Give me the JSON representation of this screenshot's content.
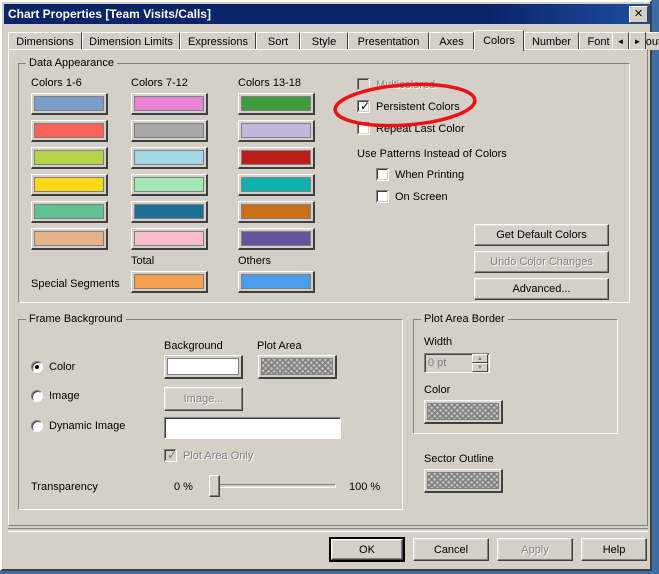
{
  "window": {
    "title": "Chart Properties [Team Visits/Calls]",
    "close_label": "✕"
  },
  "tabs": {
    "items": [
      {
        "label": "Dimensions",
        "active": false
      },
      {
        "label": "Dimension Limits",
        "active": false
      },
      {
        "label": "Expressions",
        "active": false
      },
      {
        "label": "Sort",
        "active": false
      },
      {
        "label": "Style",
        "active": false
      },
      {
        "label": "Presentation",
        "active": false
      },
      {
        "label": "Axes",
        "active": false
      },
      {
        "label": "Colors",
        "active": true
      },
      {
        "label": "Number",
        "active": false
      },
      {
        "label": "Font",
        "active": false
      },
      {
        "label": "Layout",
        "active": false
      }
    ],
    "scroll_left": "◄",
    "scroll_right": "►"
  },
  "data_appearance": {
    "group_label": "Data Appearance",
    "col1_label": "Colors 1-6",
    "col2_label": "Colors 7-12",
    "col3_label": "Colors 13-18",
    "special_segments_label": "Special Segments",
    "total_label": "Total",
    "others_label": "Others",
    "colors_1_6": [
      "#7b9dcb",
      "#f8615a",
      "#b5d44a",
      "#f7d917",
      "#5fc294",
      "#e8b38a"
    ],
    "colors_7_12": [
      "#ea82d6",
      "#a8a8a8",
      "#a3d7e8",
      "#a3e9b4",
      "#1a6f96",
      "#f8bccb"
    ],
    "colors_13_18": [
      "#3e9e3e",
      "#c4b5de",
      "#bb1d1d",
      "#10b0ad",
      "#cc7018",
      "#66519b"
    ],
    "total_color": "#f4a košt",
    "total_color_hex": "#f4a04d",
    "others_color_hex": "#4a9ded",
    "checkboxes": [
      {
        "label": "Multicolored",
        "checked": false,
        "disabled": true
      },
      {
        "label": "Persistent Colors",
        "checked": true,
        "disabled": false
      },
      {
        "label": "Repeat Last Color",
        "checked": false,
        "disabled": false
      }
    ],
    "patterns_label": "Use Patterns Instead of Colors",
    "pattern_checkboxes": [
      {
        "label": "When Printing",
        "checked": false,
        "disabled": false
      },
      {
        "label": "On Screen",
        "checked": false,
        "disabled": false
      }
    ],
    "buttons": [
      {
        "label": "Get Default Colors",
        "disabled": false
      },
      {
        "label": "Undo Color Changes",
        "disabled": true
      },
      {
        "label": "Advanced...",
        "disabled": false
      }
    ]
  },
  "frame_background": {
    "group_label": "Frame Background",
    "background_label": "Background",
    "plot_area_label": "Plot Area",
    "radios": [
      {
        "label": "Color",
        "selected": true
      },
      {
        "label": "Image",
        "selected": false
      },
      {
        "label": "Dynamic Image",
        "selected": false
      }
    ],
    "background_swatch_color": "#ffffff",
    "image_button_label": "Image...",
    "image_button_disabled": true,
    "dynamic_image_value": "",
    "plot_area_only_label": "Plot Area Only",
    "plot_area_only_checked": true,
    "plot_area_only_disabled": true,
    "transparency_label": "Transparency",
    "transparency_min_label": "0 %",
    "transparency_max_label": "100 %",
    "transparency_value": 0
  },
  "plot_area_border": {
    "group_label": "Plot Area Border",
    "width_label": "Width",
    "width_value": "0 pt",
    "width_disabled": true,
    "color_label": "Color",
    "spin_up": "▲",
    "spin_down": "▼"
  },
  "sector_outline": {
    "label": "Sector Outline"
  },
  "footer": {
    "buttons": [
      {
        "label": "OK",
        "disabled": false,
        "default": true
      },
      {
        "label": "Cancel",
        "disabled": false,
        "default": false
      },
      {
        "label": "Apply",
        "disabled": true,
        "default": false
      },
      {
        "label": "Help",
        "disabled": false,
        "default": false
      }
    ]
  },
  "annotation": {
    "shape": "red-ellipse",
    "color": "#ee1111",
    "target": "Persistent Colors"
  }
}
